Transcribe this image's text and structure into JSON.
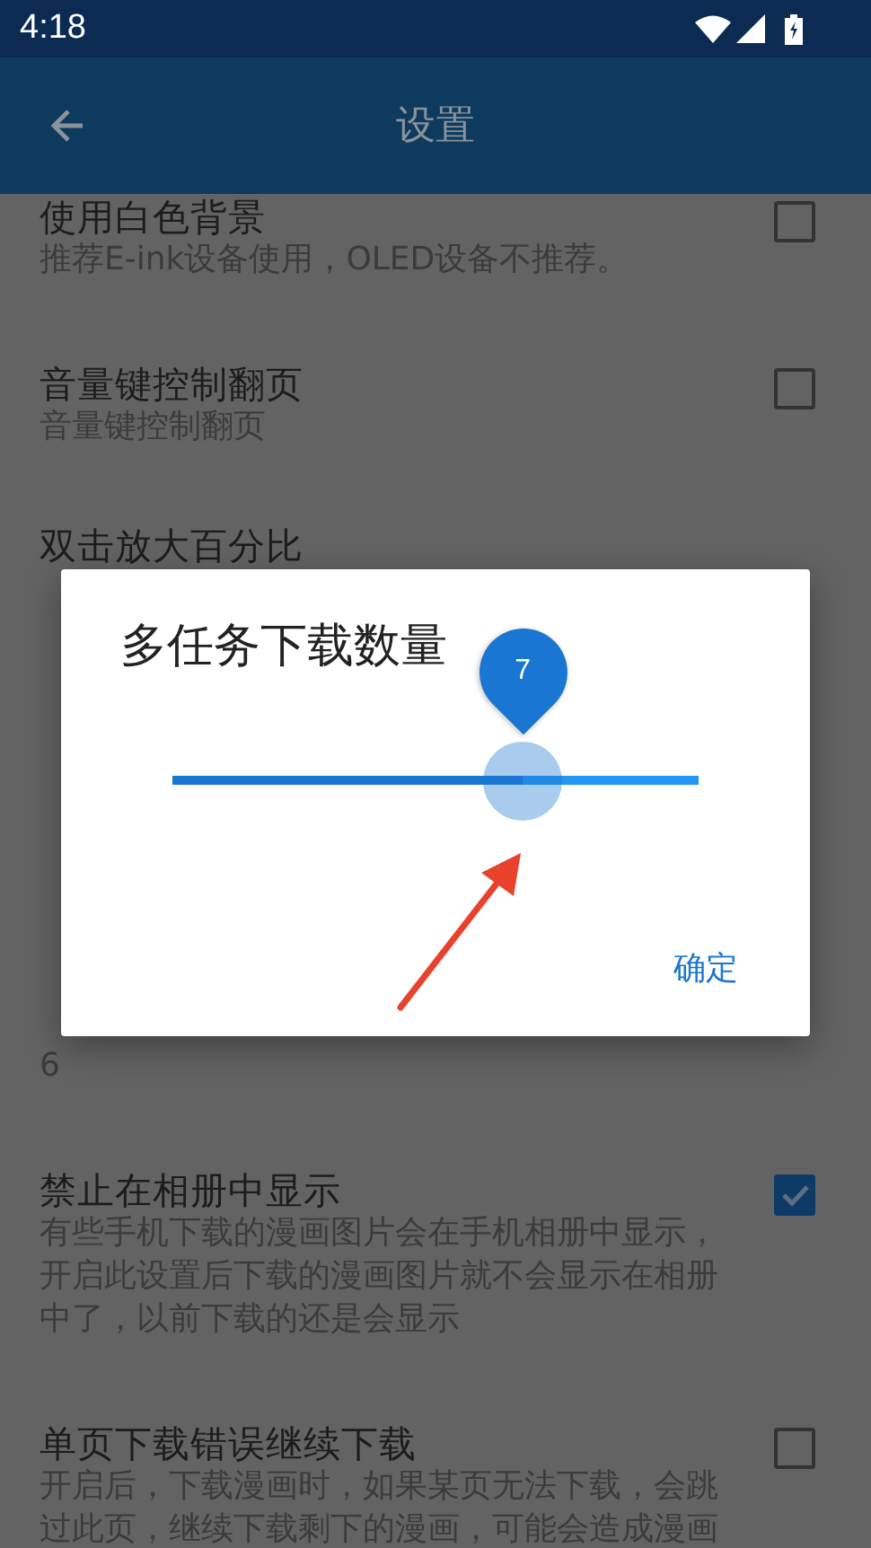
{
  "status_bar": {
    "time": "4:18"
  },
  "app_bar": {
    "title": "设置"
  },
  "settings": [
    {
      "kind": "checkbox",
      "title": "使用白色背景",
      "summary": [
        "推荐E-ink设备使用，OLED设备不推荐。"
      ],
      "checked": false
    },
    {
      "kind": "checkbox",
      "title": "音量键控制翻页",
      "summary": [
        "音量键控制翻页"
      ],
      "checked": false
    },
    {
      "kind": "value",
      "title": "双击放大百分比"
    },
    {
      "kind": "value",
      "summary": [
        "6"
      ]
    },
    {
      "kind": "checkbox",
      "title": "禁止在相册中显示",
      "summary": [
        "有些手机下载的漫画图片会在手机相册中显示，",
        "开启此设置后下载的漫画图片就不会显示在相册",
        "中了，以前下载的还是会显示"
      ],
      "checked": true
    },
    {
      "kind": "checkbox",
      "title": "单页下载错误继续下载",
      "summary": [
        "开启后，下载漫画时，如果某页无法下载，会跳",
        "过此页，继续下载剩下的漫画，可能会造成漫画"
      ],
      "checked": false
    }
  ],
  "dialog": {
    "title": "多任务下载数量",
    "slider": {
      "level": 0.666,
      "value_label": "7"
    },
    "buttons": [
      "确定"
    ]
  }
}
